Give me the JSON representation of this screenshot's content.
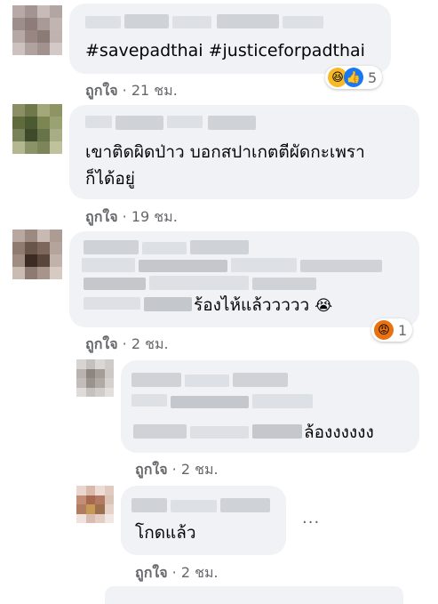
{
  "comments": [
    {
      "text": "#savepadthai #justiceforpadthai",
      "like_label": "ถูกใจ",
      "time": "21 ชม.",
      "reaction_count": "5"
    },
    {
      "text_line1": "เขาติดผิดป่าว บอกสปาเกตตีผัดกะเพรา",
      "text_line2": "ก็ได้อยู่",
      "like_label": "ถูกใจ",
      "time": "19 ชม."
    },
    {
      "text": "ร้องไห้แล้ววววว",
      "like_label": "ถูกใจ",
      "time": "2 ชม.",
      "reaction_count": "1"
    },
    {
      "text": "ล้องงงงงง",
      "like_label": "ถูกใจ",
      "time": "2 ชม."
    },
    {
      "text": "โกดแล้ว",
      "like_label": "ถูกใจ",
      "time": "2 ชม.",
      "more_label": "..."
    }
  ],
  "separator": "·",
  "icons": {
    "laugh": "laugh-react-icon",
    "like": "like-react-icon",
    "cry": "crying-face-icon",
    "angry": "angry-react-icon"
  },
  "colors": {
    "bubble": "#f0f2f5",
    "meta": "#65676b",
    "like_blue": "#1877f2",
    "angry": "#e9710f",
    "laugh": "#f7b928"
  }
}
